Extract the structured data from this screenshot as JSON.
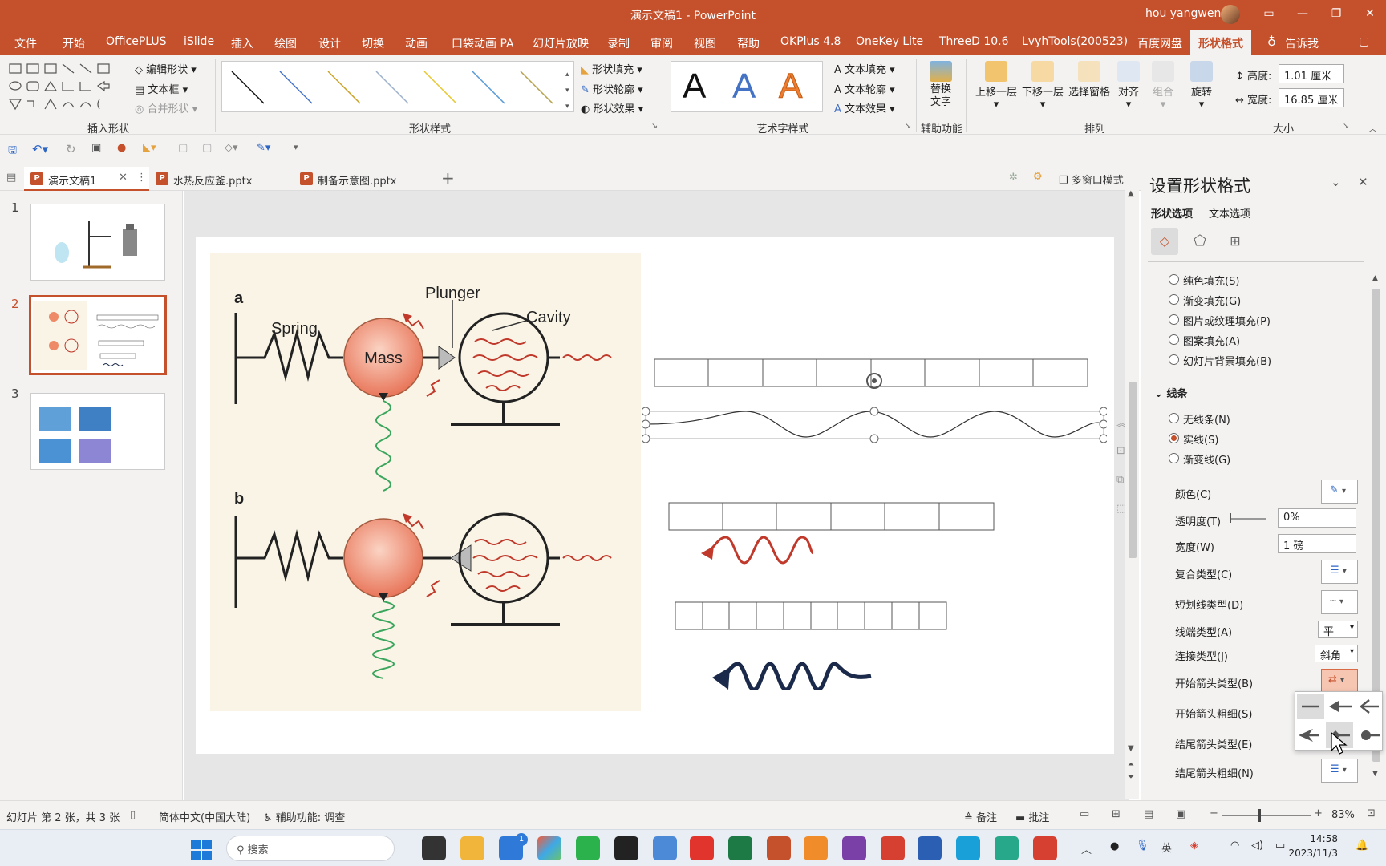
{
  "window": {
    "title": "演示文稿1 - PowerPoint",
    "user": "hou yangwen"
  },
  "menu": [
    "文件",
    "开始",
    "OfficePLUS",
    "iSlide",
    "插入",
    "绘图",
    "设计",
    "切换",
    "动画",
    "口袋动画 PA",
    "幻灯片放映",
    "录制",
    "审阅",
    "视图",
    "帮助",
    "OKPlus 4.8",
    "OneKey Lite",
    "ThreeD 10.6",
    "LvyhTools(200523)",
    "百度网盘",
    "形状格式",
    "告诉我"
  ],
  "ribbon": {
    "edit_shape": "编辑形状",
    "textbox": "文本框",
    "merge_shape": "合并形状",
    "insert_shapes_label": "插入形状",
    "shape_styles_label": "形状样式",
    "shape_fill": "形状填充",
    "shape_outline": "形状轮廓",
    "shape_effects": "形状效果",
    "wordart_label": "艺术字样式",
    "text_fill": "文本填充",
    "text_outline": "文本轮廓",
    "text_effects": "文本效果",
    "alt_text": "替换文字",
    "accessibility_label": "辅助功能",
    "bring_forward": "上移一层",
    "send_backward": "下移一层",
    "selection_pane": "选择窗格",
    "align": "对齐",
    "group": "组合",
    "rotate": "旋转",
    "arrange_label": "排列",
    "height_label": "高度:",
    "height_value": "1.01 厘米",
    "width_label": "宽度:",
    "width_value": "16.85 厘米",
    "size_label": "大小",
    "wordart_letter": "A"
  },
  "tabs": [
    {
      "label": "演示文稿1"
    },
    {
      "label": "水热反应釜.pptx"
    },
    {
      "label": "制备示意图.pptx"
    }
  ],
  "tabs_add": "+",
  "multi_window": "多窗口模式",
  "thumbnails": [
    {
      "num": "1"
    },
    {
      "num": "2"
    },
    {
      "num": "3"
    }
  ],
  "figure": {
    "label_a": "a",
    "label_b": "b",
    "spring": "Spring",
    "mass": "Mass",
    "plunger": "Plunger",
    "cavity": "Cavity"
  },
  "format_pane": {
    "title": "设置形状格式",
    "tab_shape": "形状选项",
    "tab_text": "文本选项",
    "fill_options": [
      "纯色填充(S)",
      "渐变填充(G)",
      "图片或纹理填充(P)",
      "图案填充(A)",
      "幻灯片背景填充(B)"
    ],
    "line_section": "线条",
    "line_options": [
      "无线条(N)",
      "实线(S)",
      "渐变线(G)"
    ],
    "color": "颜色(C)",
    "transparency": "透明度(T)",
    "transparency_value": "0%",
    "width": "宽度(W)",
    "width_value": "1 磅",
    "compound": "复合类型(C)",
    "dash": "短划线类型(D)",
    "cap": "线端类型(A)",
    "cap_value": "平",
    "join": "连接类型(J)",
    "join_value": "斜角",
    "begin_arrow_type": "开始箭头类型(B)",
    "begin_arrow_size": "开始箭头粗细(S)",
    "end_arrow_type": "结尾箭头类型(E)",
    "end_arrow_size": "结尾箭头粗细(N)"
  },
  "status": {
    "slide_info": "幻灯片 第 2 张，共 3 张",
    "language": "简体中文(中国大陆)",
    "accessibility": "辅助功能: 调查",
    "notes": "备注",
    "comments": "批注",
    "zoom": "83%"
  },
  "taskbar": {
    "search": "搜索",
    "time": "14:58",
    "date": "2023/11/3",
    "mail_badge": "1"
  },
  "colors": {
    "accent": "#c5502c",
    "wave_red": "#c0392b",
    "wave_navy": "#1b2a4a",
    "spring_green": "#3aa55c"
  }
}
